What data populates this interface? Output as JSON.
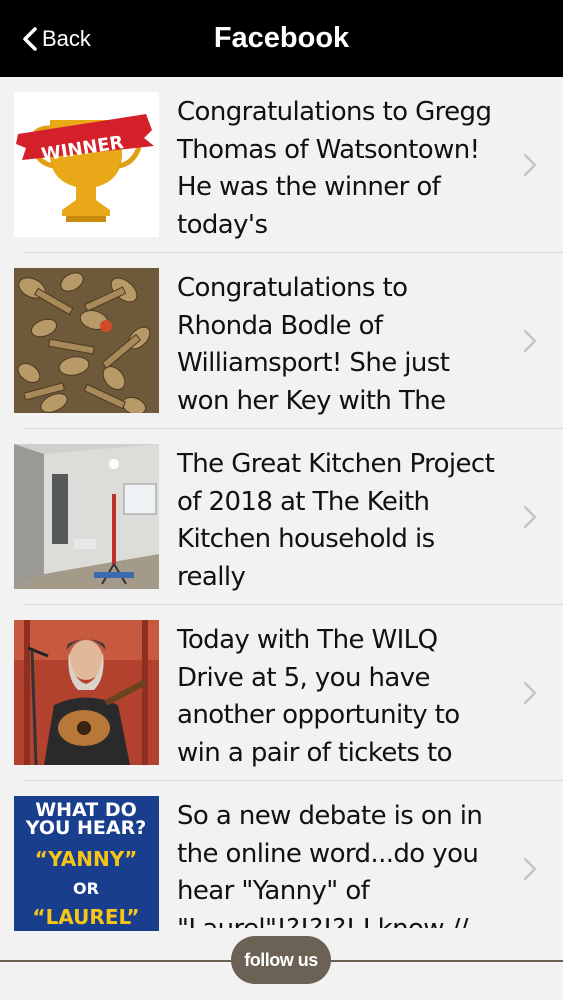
{
  "navbar": {
    "back_label": "Back",
    "title": "Facebook"
  },
  "posts": [
    {
      "text": "Congratulations to Gregg Thomas of Watsontown! He was the winner of today's",
      "thumb_icon": "winner-trophy-image"
    },
    {
      "text": "Congratulations to Rhonda Bodle of Williamsport! She just won her Key with The",
      "thumb_icon": "keys-image"
    },
    {
      "text": "The Great Kitchen Project of 2018 at The Keith Kitchen household is really",
      "thumb_icon": "kitchen-renovation-image"
    },
    {
      "text": "Today with The WILQ Drive at 5, you have another opportunity to win a pair of tickets to",
      "thumb_icon": "guitarist-image"
    },
    {
      "text": "So a new debate is on in the online word...do you hear \"Yanny\" of \"Laurel\"!?!?!?! I know //",
      "thumb_icon": "yanny-laurel-image",
      "thumb_text": {
        "line1": "WHAT DO",
        "line2": "YOU HEAR?",
        "line3": "“YANNY”",
        "line4": "OR",
        "line5": "“LAUREL”"
      }
    }
  ],
  "footer": {
    "follow_label": "follow us"
  },
  "colors": {
    "navbar_bg": "#000000",
    "list_bg": "#f2f2f2",
    "follow_bg": "#6b6255"
  }
}
